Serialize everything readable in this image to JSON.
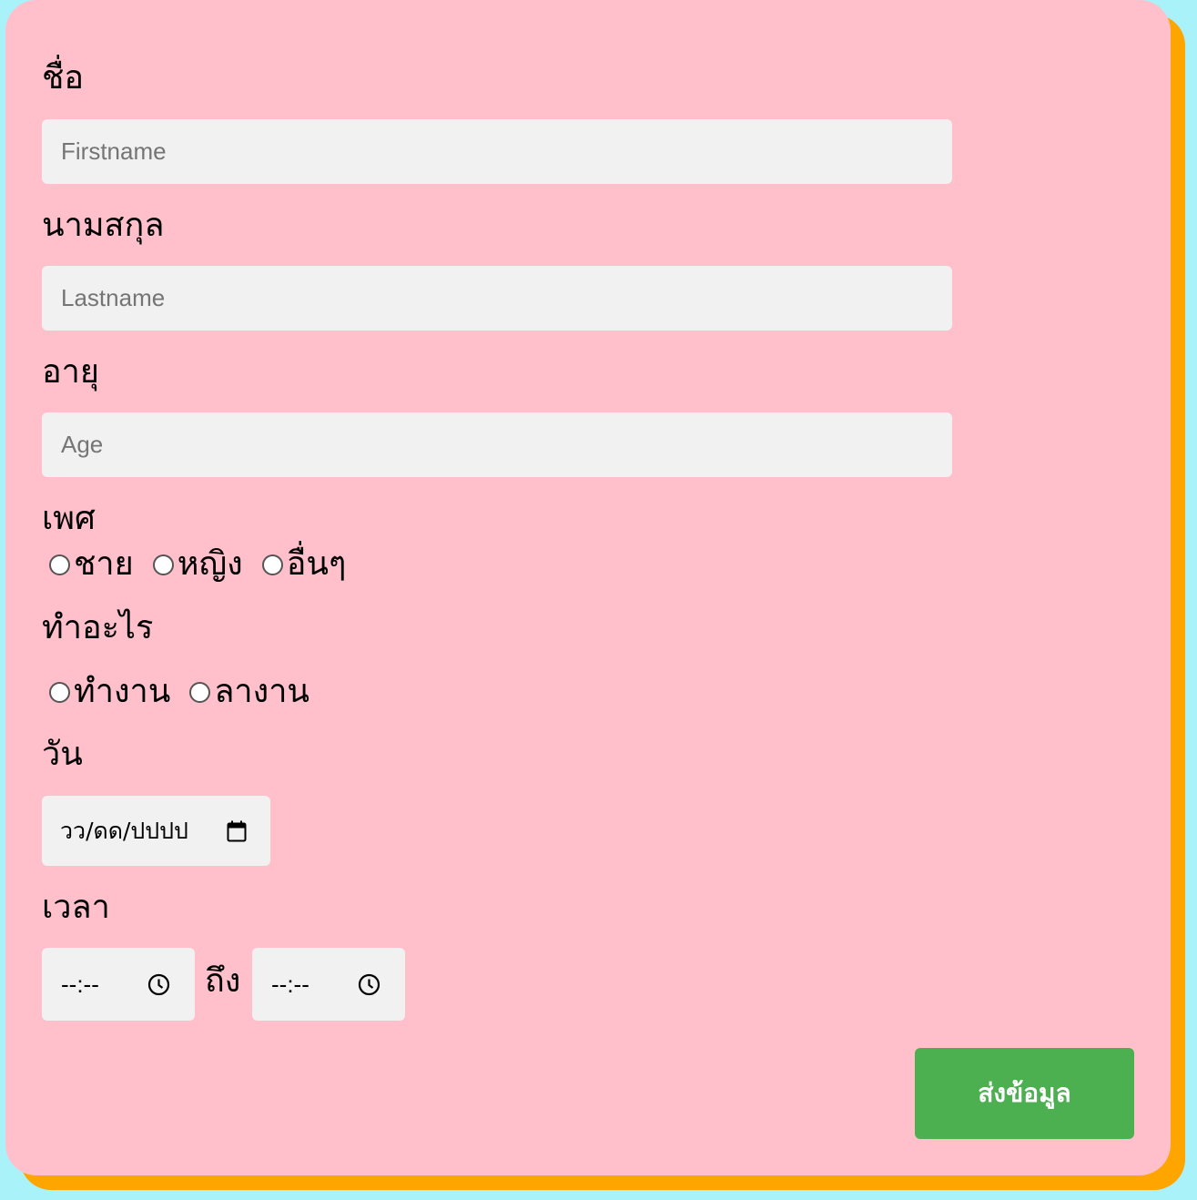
{
  "form": {
    "firstname": {
      "label": "ชื่อ",
      "placeholder": "Firstname",
      "value": ""
    },
    "lastname": {
      "label": "นามสกุล",
      "placeholder": "Lastname",
      "value": ""
    },
    "age": {
      "label": "อายุ",
      "placeholder": "Age",
      "value": ""
    },
    "gender": {
      "label": "เพศ",
      "options": [
        "ชาย",
        "หญิง",
        "อื่นๆ"
      ],
      "selected": null
    },
    "occupation": {
      "label": "ทำอะไร",
      "options": [
        "ทำงาน",
        "ลางาน"
      ],
      "selected": null
    },
    "date": {
      "label": "วัน",
      "value": "วว/ดด/ปปปป",
      "icon": "calendar-icon"
    },
    "time": {
      "label": "เวลา",
      "start_value": "--:--",
      "to_label": "ถึง",
      "end_value": "--:--",
      "icon": "clock-icon"
    },
    "submit_label": "ส่งข้อมูล"
  },
  "colors": {
    "page_background": "#a9f2fa",
    "card_background": "#ffbfcb",
    "card_shadow": "#ffa500",
    "input_background": "#f1f1f1",
    "submit_background": "#4caf50"
  }
}
